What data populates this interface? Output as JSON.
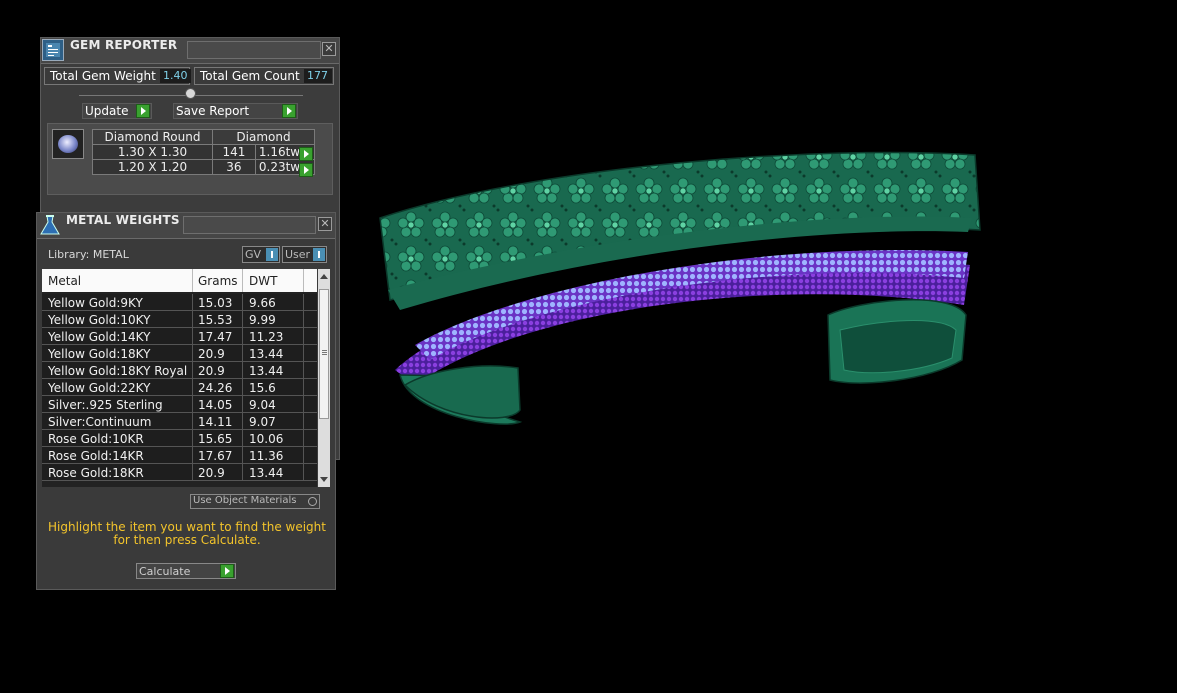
{
  "gem_reporter": {
    "title": "GEM REPORTER",
    "close": "✕",
    "total_weight_label": "Total Gem Weight",
    "total_weight_value": "1.40",
    "total_count_label": "Total Gem Count",
    "total_count_value": "177",
    "update_label": "Update",
    "save_report_label": "Save Report",
    "table": {
      "headers": [
        "Diamond Round",
        "Diamond"
      ],
      "rows": [
        {
          "size": "1.30 X 1.30",
          "count": "141",
          "weight": "1.16tw"
        },
        {
          "size": "1.20 X 1.20",
          "count": "36",
          "weight": "0.23tw"
        }
      ]
    }
  },
  "metal_weights": {
    "title": "METAL WEIGHTS",
    "close": "✕",
    "library_label": "Library: METAL",
    "toggles": [
      "GV",
      "User"
    ],
    "columns": [
      "Metal",
      "Grams",
      "DWT"
    ],
    "rows": [
      {
        "metal": "Yellow Gold:9KY",
        "grams": "15.03",
        "dwt": "9.66"
      },
      {
        "metal": "Yellow Gold:10KY",
        "grams": "15.53",
        "dwt": "9.99"
      },
      {
        "metal": "Yellow Gold:14KY",
        "grams": "17.47",
        "dwt": "11.23"
      },
      {
        "metal": "Yellow Gold:18KY",
        "grams": "20.9",
        "dwt": "13.44"
      },
      {
        "metal": "Yellow Gold:18KY Royal",
        "grams": "20.9",
        "dwt": "13.44"
      },
      {
        "metal": "Yellow Gold:22KY",
        "grams": "24.26",
        "dwt": "15.6"
      },
      {
        "metal": "Silver:.925 Sterling",
        "grams": "14.05",
        "dwt": "9.04"
      },
      {
        "metal": "Silver:Continuum",
        "grams": "14.11",
        "dwt": "9.07"
      },
      {
        "metal": "Rose Gold:10KR",
        "grams": "15.65",
        "dwt": "10.06"
      },
      {
        "metal": "Rose Gold:14KR",
        "grams": "17.67",
        "dwt": "11.36"
      },
      {
        "metal": "Rose Gold:18KR",
        "grams": "20.9",
        "dwt": "13.44"
      }
    ],
    "use_object_materials_label": "Use Object Materials",
    "hint": "Highlight the item you want to find the weight for then press Calculate.",
    "calculate_label": "Calculate"
  },
  "colors": {
    "band": "#1e7a5e",
    "band_dark": "#0f4f3b",
    "stones_purple": "#7a2fc8",
    "stones_blue": "#8aa7ff",
    "hint_yellow": "#f3c42b"
  }
}
